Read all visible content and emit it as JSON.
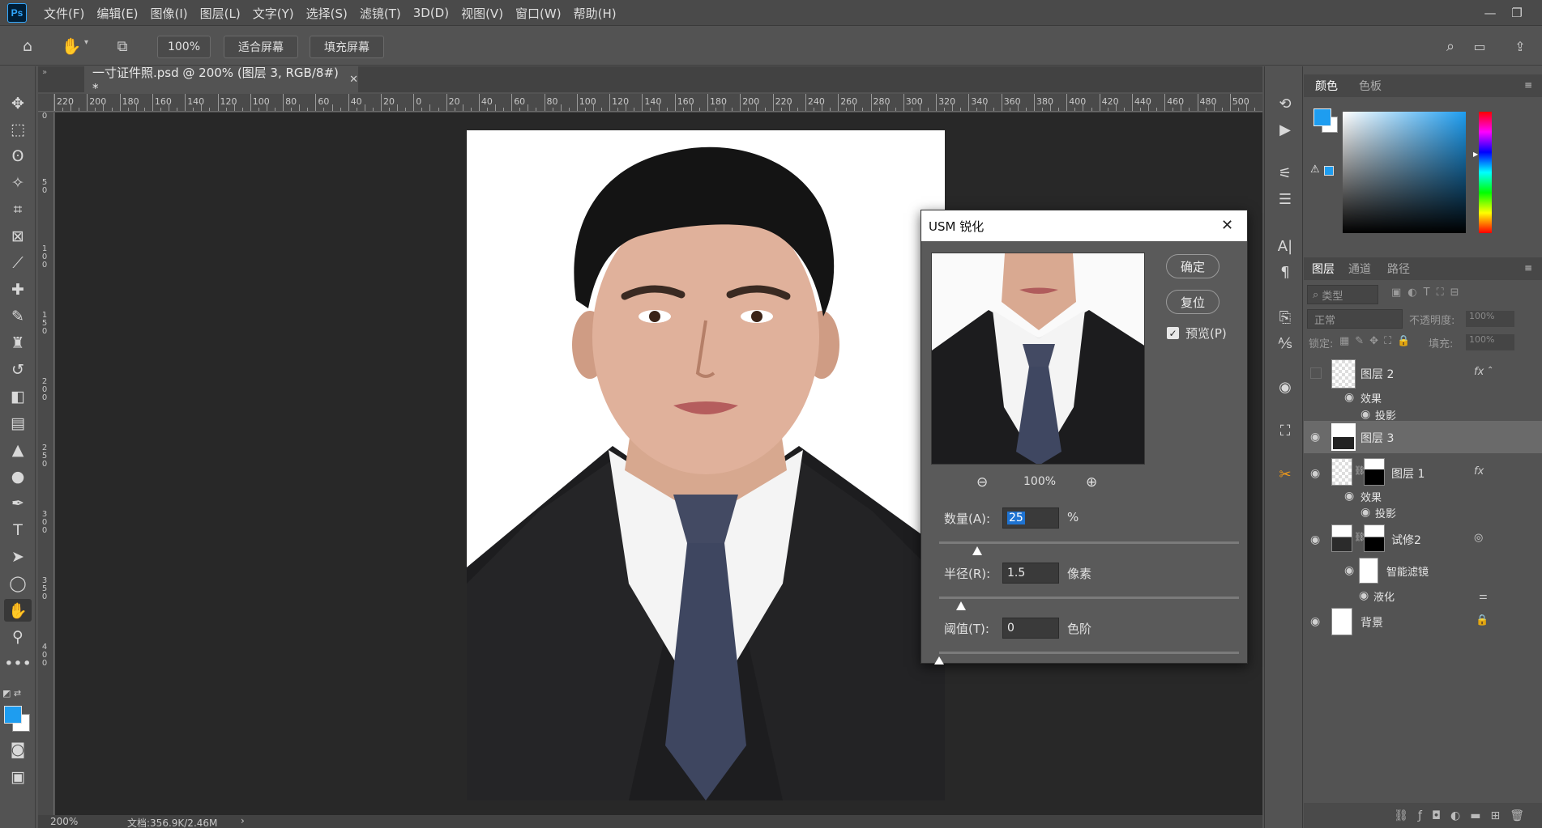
{
  "app": {
    "logo": "Ps"
  },
  "menu": [
    "文件(F)",
    "编辑(E)",
    "图像(I)",
    "图层(L)",
    "文字(Y)",
    "选择(S)",
    "滤镜(T)",
    "3D(D)",
    "视图(V)",
    "窗口(W)",
    "帮助(H)"
  ],
  "options": {
    "zoom_value": "100%",
    "fit_screen": "适合屏幕",
    "fill_screen": "填充屏幕"
  },
  "document": {
    "tab_title": "一寸证件照.psd @ 200% (图层 3, RGB/8#) *",
    "ruler_h": [
      "220",
      "200",
      "180",
      "160",
      "140",
      "120",
      "100",
      "80",
      "60",
      "40",
      "20",
      "0",
      "20",
      "40",
      "60",
      "80",
      "100",
      "120",
      "140",
      "160",
      "180",
      "200",
      "220",
      "240",
      "260",
      "280",
      "300",
      "320",
      "340",
      "360",
      "380",
      "400",
      "420",
      "440",
      "460",
      "480",
      "500"
    ],
    "ruler_v": [
      "0",
      "50",
      "100",
      "150",
      "200",
      "250",
      "300",
      "350",
      "400"
    ],
    "status_zoom": "200%",
    "status_doc": "文档:356.9K/2.46M"
  },
  "usm_dialog": {
    "title": "USM 锐化",
    "ok": "确定",
    "reset": "复位",
    "preview_label": "预览(P)",
    "preview_checked": true,
    "preview_zoom": "100%",
    "amount_label": "数量(A):",
    "amount_value": "25",
    "amount_unit": "%",
    "radius_label": "半径(R):",
    "radius_value": "1.5",
    "radius_unit": "像素",
    "threshold_label": "阈值(T):",
    "threshold_value": "0",
    "threshold_unit": "色阶"
  },
  "color_panel": {
    "tab_color": "颜色",
    "tab_swatches": "色板",
    "foreground": "#1e9df0",
    "background": "#ffffff"
  },
  "layers_panel": {
    "tab_layers": "图层",
    "tab_channels": "通道",
    "tab_paths": "路径",
    "filter_kind": "类型",
    "blend_mode": "正常",
    "opacity_label": "不透明度:",
    "opacity_value": "100%",
    "lock_label": "锁定:",
    "fill_label": "填充:",
    "fill_value": "100%",
    "layers": [
      {
        "name": "图层 2",
        "effects": "效果",
        "effect1": "投影"
      },
      {
        "name": "图层 3"
      },
      {
        "name": "图层 1",
        "effects": "效果",
        "effect1": "投影"
      },
      {
        "name": "试修2",
        "smart_filters": "智能滤镜",
        "filter1": "液化"
      },
      {
        "name": "背景"
      }
    ]
  }
}
